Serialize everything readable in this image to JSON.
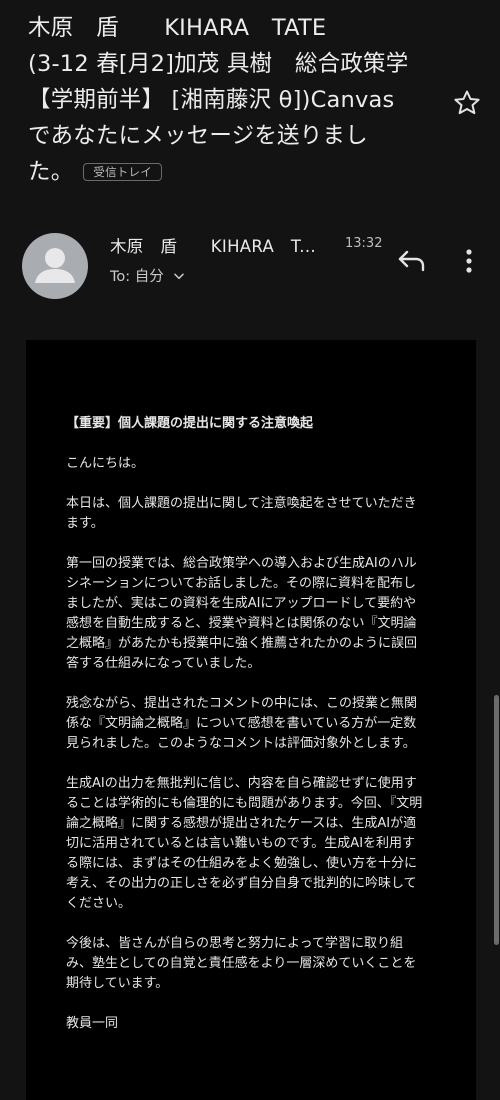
{
  "subject": {
    "lines": [
      "木原　盾　　KIHARA　TATE",
      "(3-12 春[月2]加茂 具樹　総合政策学",
      "【学期前半】 [湘南藤沢 θ])Canvas",
      "であなたにメッセージを送りまし",
      "た。"
    ],
    "label": "受信トレイ"
  },
  "sender": {
    "name": "木原　盾　　KIHARA　T...",
    "time": "13:32",
    "to_label": "To: 自分"
  },
  "message": {
    "heading": "【重要】個人課題の提出に関する注意喚起",
    "paragraphs": [
      "こんにちは。",
      "本日は、個人課題の提出に関して注意喚起をさせていただきます。",
      "第一回の授業では、総合政策学への導入および生成AIのハルシネーションについてお話しました。その際に資料を配布しましたが、実はこの資料を生成AIにアップロードして要約や感想を自動生成すると、授業や資料とは関係のない『文明論之概略』があたかも授業中に強く推薦されたかのように誤回答する仕組みになっていました。",
      "残念ながら、提出されたコメントの中には、この授業と無関係な『文明論之概略』について感想を書いている方が一定数見られました。このようなコメントは評価対象外とします。",
      "生成AIの出力を無批判に信じ、内容を自ら確認せずに使用することは学術的にも倫理的にも問題があります。今回、『文明論之概略』に関する感想が提出されたケースは、生成AIが適切に活用されているとは言い難いものです。生成AIを利用する際には、まずはその仕組みをよく勉強し、使い方を十分に考え、その出力の正しさを必ず自分自身で批判的に吟味してください。",
      "今後は、皆さんが自らの思考と努力によって学習に取り組み、塾生としての自覚と責任感をより一層深めていくことを期待しています。",
      "教員一同"
    ]
  },
  "icons": {
    "star": "star-outline-icon",
    "avatar": "person-avatar-icon",
    "reply": "reply-arrow-icon",
    "more": "more-vertical-icon",
    "chevron": "chevron-down-icon"
  },
  "colors": {
    "background": "#131314",
    "message_body": "#000000",
    "text": "#e3e3e3",
    "avatar": "#a9acb1"
  }
}
